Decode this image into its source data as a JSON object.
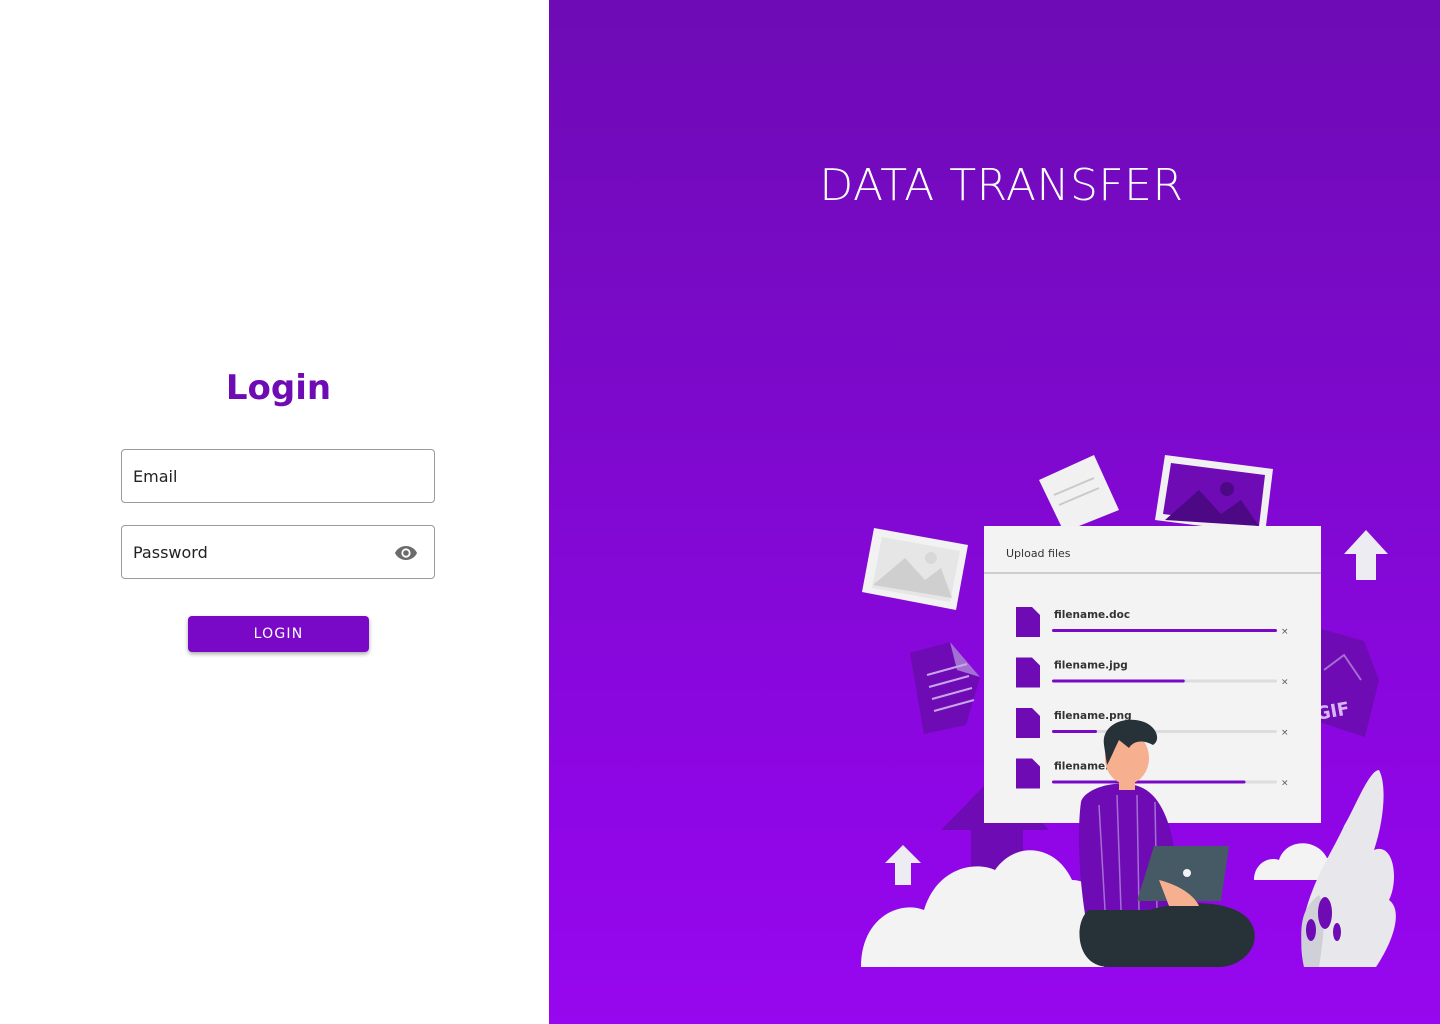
{
  "login": {
    "title": "Login",
    "email_placeholder": "Email",
    "password_placeholder": "Password",
    "submit_label": "LOGIN"
  },
  "hero": {
    "title": "DATA TRANSFER",
    "illustration": {
      "panel_title": "Upload files",
      "files": [
        {
          "name": "filename.doc",
          "progress": 1.0
        },
        {
          "name": "filename.jpg",
          "progress": 0.59
        },
        {
          "name": "filename.png",
          "progress": 0.2
        },
        {
          "name": "filename.pdf",
          "progress": 0.86
        }
      ],
      "badge_text": "GIF"
    }
  },
  "colors": {
    "accent": "#7a09c7",
    "title": "#6e0bb5",
    "gradient_top": "#6e0bb5",
    "gradient_bottom": "#9707ef"
  }
}
